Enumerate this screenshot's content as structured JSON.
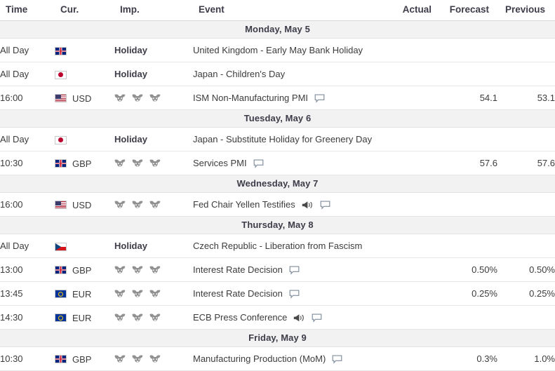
{
  "table": {
    "columns": [
      {
        "key": "time",
        "label": "Time"
      },
      {
        "key": "cur",
        "label": "Cur."
      },
      {
        "key": "imp",
        "label": "Imp."
      },
      {
        "key": "event",
        "label": "Event"
      },
      {
        "key": "actual",
        "label": "Actual"
      },
      {
        "key": "forecast",
        "label": "Forecast"
      },
      {
        "key": "previous",
        "label": "Previous"
      }
    ],
    "rows": [
      {
        "type": "day",
        "label": "Monday, May 5"
      },
      {
        "type": "event",
        "time": "All Day",
        "flag": "gb",
        "currency": "",
        "importance": 0,
        "holiday_label": "Holiday",
        "event": "United Kingdom - Early May Bank Holiday",
        "icons": [],
        "actual": "",
        "forecast": "",
        "previous": ""
      },
      {
        "type": "event",
        "time": "All Day",
        "flag": "jp",
        "currency": "",
        "importance": 0,
        "holiday_label": "Holiday",
        "event": "Japan - Children's Day",
        "icons": [],
        "actual": "",
        "forecast": "",
        "previous": ""
      },
      {
        "type": "event",
        "time": "16:00",
        "flag": "us",
        "currency": "USD",
        "importance": 3,
        "holiday_label": "",
        "event": "ISM Non-Manufacturing PMI",
        "icons": [
          "comment-icon"
        ],
        "actual": "",
        "forecast": "54.1",
        "previous": "53.1"
      },
      {
        "type": "day",
        "label": "Tuesday, May 6"
      },
      {
        "type": "event",
        "time": "All Day",
        "flag": "jp",
        "currency": "",
        "importance": 0,
        "holiday_label": "Holiday",
        "event": "Japan - Substitute Holiday for Greenery Day",
        "icons": [],
        "actual": "",
        "forecast": "",
        "previous": ""
      },
      {
        "type": "event",
        "time": "10:30",
        "flag": "gb",
        "currency": "GBP",
        "importance": 3,
        "holiday_label": "",
        "event": "Services PMI",
        "icons": [
          "comment-icon"
        ],
        "actual": "",
        "forecast": "57.6",
        "previous": "57.6"
      },
      {
        "type": "day",
        "label": "Wednesday, May 7"
      },
      {
        "type": "event",
        "time": "16:00",
        "flag": "us",
        "currency": "USD",
        "importance": 3,
        "holiday_label": "",
        "event": "Fed Chair Yellen Testifies",
        "icons": [
          "megaphone-icon",
          "comment-icon"
        ],
        "actual": "",
        "forecast": "",
        "previous": ""
      },
      {
        "type": "day",
        "label": "Thursday, May 8"
      },
      {
        "type": "event",
        "time": "All Day",
        "flag": "cz",
        "currency": "",
        "importance": 0,
        "holiday_label": "Holiday",
        "event": "Czech Republic - Liberation from Fascism",
        "icons": [],
        "actual": "",
        "forecast": "",
        "previous": ""
      },
      {
        "type": "event",
        "time": "13:00",
        "flag": "gb",
        "currency": "GBP",
        "importance": 3,
        "holiday_label": "",
        "event": "Interest Rate Decision",
        "icons": [
          "comment-icon"
        ],
        "actual": "",
        "forecast": "0.50%",
        "previous": "0.50%"
      },
      {
        "type": "event",
        "time": "13:45",
        "flag": "eu",
        "currency": "EUR",
        "importance": 3,
        "holiday_label": "",
        "event": "Interest Rate Decision",
        "icons": [
          "comment-icon"
        ],
        "actual": "",
        "forecast": "0.25%",
        "previous": "0.25%"
      },
      {
        "type": "event",
        "time": "14:30",
        "flag": "eu",
        "currency": "EUR",
        "importance": 3,
        "holiday_label": "",
        "event": "ECB Press Conference",
        "icons": [
          "megaphone-icon",
          "comment-icon"
        ],
        "actual": "",
        "forecast": "",
        "previous": ""
      },
      {
        "type": "day",
        "label": "Friday, May 9"
      },
      {
        "type": "event",
        "time": "10:30",
        "flag": "gb",
        "currency": "GBP",
        "importance": 3,
        "holiday_label": "",
        "event": "Manufacturing Production (MoM)",
        "icons": [
          "comment-icon"
        ],
        "actual": "",
        "forecast": "0.3%",
        "previous": "1.0%"
      }
    ]
  },
  "colors": {
    "day_row_background": "#f2f2f2",
    "text": "#3c3c3c",
    "heading_text": "#3d3d4a",
    "row_border": "#e6e6e6",
    "bull_icon": "#919191",
    "comment_icon": "#7f8c9b",
    "megaphone_icon": "#4a4a4a"
  }
}
